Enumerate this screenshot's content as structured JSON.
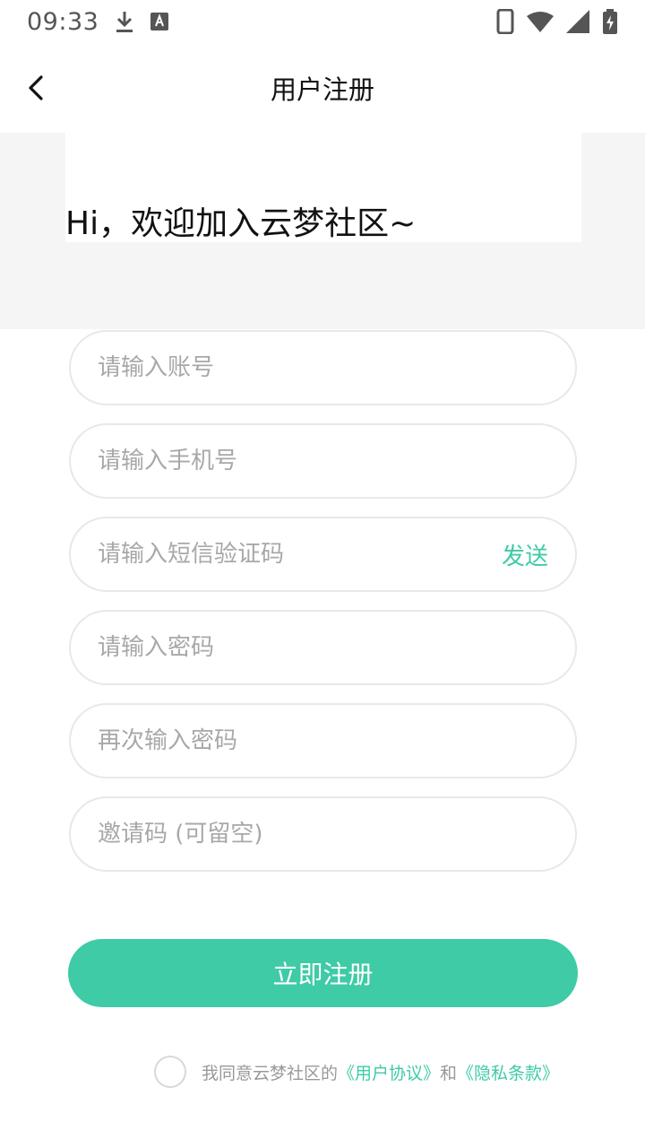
{
  "status_bar": {
    "time": "09:33",
    "icons": [
      "download-icon",
      "font-app-icon",
      "phone-icon",
      "wifi-icon",
      "signal-icon",
      "battery-charging-icon"
    ]
  },
  "nav": {
    "title": "用户注册",
    "back_icon": "chevron-left-icon"
  },
  "header": {
    "welcome": "Hi，欢迎加入云梦社区~"
  },
  "form": {
    "account_placeholder": "请输入账号",
    "phone_placeholder": "请输入手机号",
    "sms_placeholder": "请输入短信验证码",
    "send_label": "发送",
    "password_placeholder": "请输入密码",
    "confirm_placeholder": "再次输入密码",
    "invite_placeholder": "邀请码 (可留空)"
  },
  "register": {
    "label": "立即注册"
  },
  "agreement": {
    "prefix": "我同意云梦社区的",
    "user_agreement": "《用户协议》",
    "conjunction": "和",
    "privacy": "《隐私条款》",
    "checked": false
  },
  "colors": {
    "accent": "#3ecba5",
    "header_bg": "#f5f5f5",
    "border": "#e8e8e8",
    "placeholder": "#a8a8a8"
  }
}
